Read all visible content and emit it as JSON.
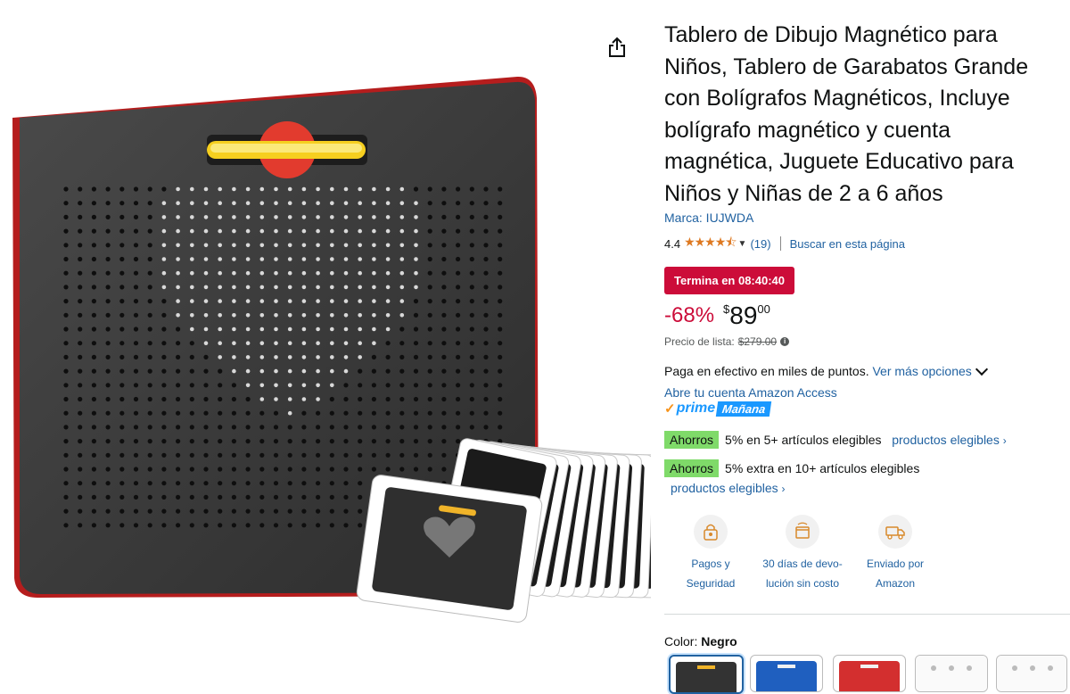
{
  "product": {
    "title": "Tablero de Dibujo Magnético para Niños, Tablero de Garabatos Grande con Bolígrafos Magnéticos, Incluye bolígrafo magnético y cuenta magnética, Juguete Educativo para Niños y Niñas de 2 a 6 años",
    "brand": "Marca: IUJWDA"
  },
  "rating": {
    "value": "4.4",
    "stars": "★★★★⯪",
    "count": "(19)",
    "search_link": "Buscar en esta página"
  },
  "deal": {
    "badge": "Termina en 08:40:40",
    "discount": "-68%",
    "currency": "$",
    "price_whole": "89",
    "price_fraction": "00",
    "list_price_label": "Precio de lista:",
    "list_price": "$279.00"
  },
  "payment": {
    "text": "Paga en efectivo en miles de puntos.",
    "more_options": "Ver más opciones",
    "access_link": "Abre tu cuenta Amazon Access"
  },
  "prime": {
    "word": "prime",
    "delivery": "Mañana"
  },
  "savings": [
    {
      "badge": "Ahorros",
      "text": "5% en 5+ artículos elegibles",
      "link": "productos elegibles"
    },
    {
      "badge": "Ahorros",
      "text": "5% extra en 10+ artículos elegibles",
      "link": "productos elegibles"
    }
  ],
  "trust": [
    {
      "line1": "Pagos y",
      "line2": "Seguridad",
      "icon": "lock-icon"
    },
    {
      "line1": "30 días de devo-",
      "line2": "lución sin costo",
      "icon": "return-icon"
    },
    {
      "line1": "Enviado por",
      "line2": "Amazon",
      "icon": "truck-icon"
    }
  ],
  "color": {
    "label": "Color:",
    "selected": "Negro"
  },
  "colors": {
    "accent_link": "#2162a1",
    "deal_red": "#cc0c39",
    "savings_green": "#7fda69",
    "prime_blue": "#1a98ff",
    "star_orange": "#de7921"
  }
}
